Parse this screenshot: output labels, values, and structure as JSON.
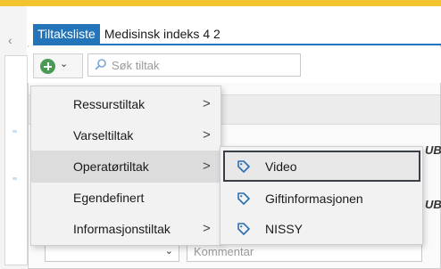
{
  "tabs": [
    "Tiltaksliste",
    "Medisinsk indeks 4 2"
  ],
  "search": {
    "placeholder": "Søk tiltak"
  },
  "menu": {
    "items": [
      {
        "label": "Ressurstiltak",
        "has_submenu": true,
        "arrow": ">"
      },
      {
        "label": "Varseltiltak",
        "has_submenu": true,
        "arrow": ">"
      },
      {
        "label": "Operatørtiltak",
        "has_submenu": true,
        "arrow": ">"
      },
      {
        "label": "Egendefinert",
        "has_submenu": false
      },
      {
        "label": "Informasjonstiltak",
        "has_submenu": true,
        "arrow": ">"
      }
    ]
  },
  "submenu": {
    "items": [
      {
        "label": "Video",
        "icon": "tag-icon"
      },
      {
        "label": "Giftinformasjonen",
        "icon": "tag-icon"
      },
      {
        "label": "NISSY",
        "icon": "tag-icon"
      }
    ]
  },
  "side_labels": {
    "ub1": "UB",
    "ub2": "UB"
  },
  "form": {
    "comment_placeholder": "Kommentar"
  },
  "colors": {
    "accent": "#f2c42d",
    "tab_active": "#2374b8",
    "add_icon": "#4a9a56",
    "tag_icon": "#2b6fb3"
  }
}
